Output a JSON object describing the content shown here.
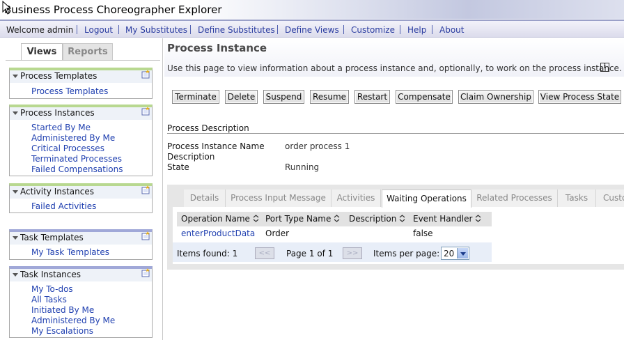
{
  "window": {
    "title": "Business Process Choreographer Explorer"
  },
  "menu": {
    "welcome": "Welcome admin",
    "items": [
      "Logout",
      "My Substitutes",
      "Define Substitutes",
      "Define Views",
      "Customize",
      "Help",
      "About"
    ]
  },
  "tabs": {
    "views": "Views",
    "reports": "Reports"
  },
  "nav": [
    {
      "title": "Process Templates",
      "links": [
        "Process Templates"
      ]
    },
    {
      "title": "Process Instances",
      "links": [
        "Started By Me",
        "Administered By Me",
        "Critical Processes",
        "Terminated Processes",
        "Failed Compensations"
      ]
    },
    {
      "title": "Activity Instances",
      "links": [
        "Failed Activities"
      ]
    },
    {
      "title": "Task Templates",
      "links": [
        "My Task Templates"
      ]
    },
    {
      "title": "Task Instances",
      "links": [
        "My To-dos",
        "All Tasks",
        "Initiated By Me",
        "Administered By Me",
        "My Escalations"
      ]
    }
  ],
  "page": {
    "title": "Process Instance",
    "description": "Use this page to view information about a process instance and, optionally, to work on the process instance.",
    "info_icon": "i"
  },
  "actions": [
    "Terminate",
    "Delete",
    "Suspend",
    "Resume",
    "Restart",
    "Compensate",
    "Claim Ownership",
    "View Process State"
  ],
  "process_description": {
    "section_title": "Process Description",
    "labels": {
      "name": "Process Instance Name",
      "description": "Description",
      "state": "State"
    },
    "values": {
      "name": "order process 1",
      "description": "",
      "state": "Running"
    }
  },
  "detail_tabs": [
    "Details",
    "Process Input Message",
    "Activities",
    "Waiting Operations",
    "Related Processes",
    "Tasks",
    "Custo"
  ],
  "active_detail_tab": "Waiting Operations",
  "table": {
    "columns": [
      "Operation Name",
      "Port Type Name",
      "Description",
      "Event Handler"
    ],
    "rows": [
      {
        "operation": "enterProductData",
        "port_type": "Order",
        "description": "",
        "event_handler": "false"
      }
    ]
  },
  "pager": {
    "items_found": "Items found: 1",
    "prev": "<<",
    "page": "Page 1 of 1",
    "next": ">>",
    "per_page_label": "Items per page:",
    "per_page_value": "20"
  }
}
